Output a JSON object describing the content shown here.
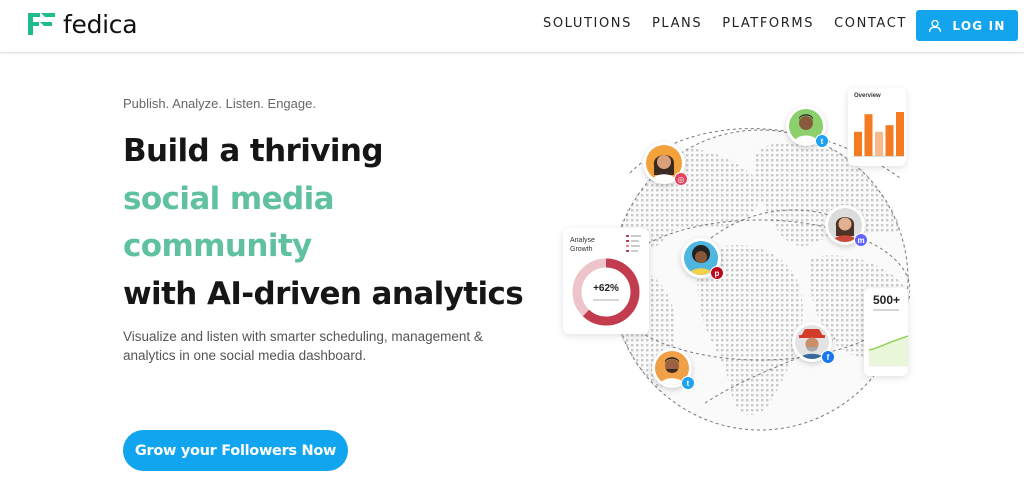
{
  "brand": {
    "name": "fedica",
    "logo_color": "#1fba8e"
  },
  "nav": {
    "items": [
      "SOLUTIONS",
      "PLANS",
      "PLATFORMS",
      "CONTACT"
    ],
    "login_label": "LOG IN",
    "login_icon": "user-icon"
  },
  "hero": {
    "tagline": "Publish. Analyze. Listen. Engage.",
    "headline_1": "Build a thriving",
    "headline_2": "social media",
    "headline_3": "community",
    "headline_4": "with AI-driven analytics",
    "description": "Visualize and listen with smarter scheduling, management & analytics in one social media dashboard.",
    "cta_label": "Grow your Followers Now"
  },
  "illustration": {
    "overview_title": "Overview",
    "overview_bars": [
      0.55,
      0.95,
      0.55,
      0.7,
      1.0
    ],
    "analyse_title_1": "Analyse",
    "analyse_title_2": "Growth",
    "analyse_value": "+62%",
    "reach_value": "500+",
    "badges": [
      "twitter-badge",
      "instagram-badge",
      "mastodon-badge",
      "pinterest-badge",
      "facebook-badge",
      "twitter-badge"
    ]
  },
  "colors": {
    "primary": "#10a5ee",
    "accent_green": "#5fc1a0",
    "overview_bar": "#f57b22",
    "donut": "#c23b4e"
  }
}
